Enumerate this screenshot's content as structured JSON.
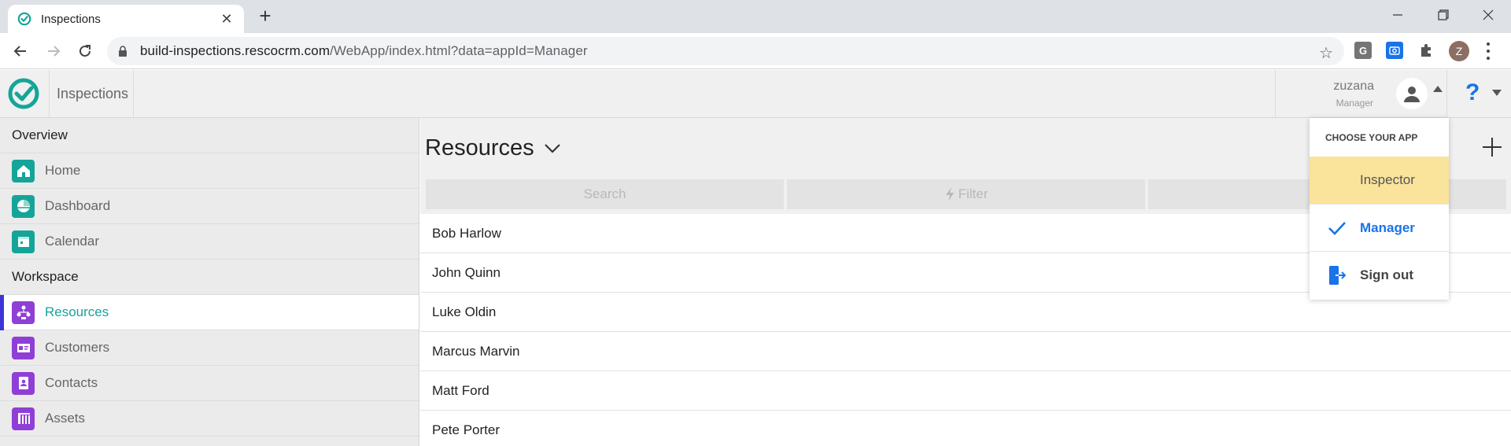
{
  "browser": {
    "tab_title": "Inspections",
    "url_host": "build-inspections.rescocrm.com",
    "url_path": "/WebApp/index.html?data=appId=Manager",
    "profile_initial": "Z",
    "new_tab_symbol": "+",
    "close_symbol": "✕",
    "star_symbol": "☆"
  },
  "app": {
    "name": "Inspections",
    "user_name": "zuzana",
    "user_role": "Manager",
    "help_symbol": "?"
  },
  "sidebar": {
    "sections": [
      {
        "title": "Overview",
        "items": [
          {
            "label": "Home",
            "icon": "home-icon"
          },
          {
            "label": "Dashboard",
            "icon": "dashboard-icon"
          },
          {
            "label": "Calendar",
            "icon": "calendar-icon"
          }
        ]
      },
      {
        "title": "Workspace",
        "items": [
          {
            "label": "Resources",
            "icon": "resources-icon",
            "active": true
          },
          {
            "label": "Customers",
            "icon": "customers-icon"
          },
          {
            "label": "Contacts",
            "icon": "contacts-icon"
          },
          {
            "label": "Assets",
            "icon": "assets-icon"
          }
        ]
      }
    ]
  },
  "main": {
    "title": "Resources",
    "search_placeholder": "Search",
    "filter_label": "Filter",
    "rows": [
      "Bob Harlow",
      "John Quinn",
      "Luke Oldin",
      "Marcus Marvin",
      "Matt Ford",
      "Pete Porter"
    ]
  },
  "app_menu": {
    "heading": "CHOOSE YOUR APP",
    "items": [
      {
        "label": "Inspector",
        "highlighted": true
      },
      {
        "label": "Manager",
        "selected": true
      },
      {
        "label": "Sign out"
      }
    ]
  },
  "colors": {
    "teal": "#14a598",
    "purple": "#8f3fd6",
    "accent_blue": "#1a73e8",
    "highlight_yellow": "#fae39b",
    "active_bar": "#3b35d8"
  }
}
